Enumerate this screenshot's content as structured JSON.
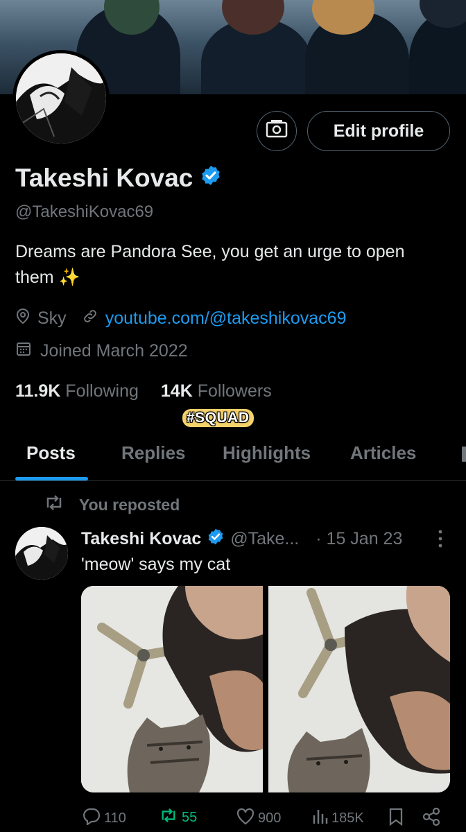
{
  "profile": {
    "name": "Takeshi Kovac",
    "handle": "@TakeshiKovac69",
    "bio": "Dreams are Pandora See, you get an urge to open them ✨",
    "location": "Sky",
    "website": "youtube.com/@takeshikovac69",
    "joined": "Joined March 2022",
    "following_count": "11.9K",
    "following_label": "Following",
    "followers_count": "14K",
    "followers_label": "Followers",
    "highlight_tag": "#SQUAD",
    "edit_button": "Edit profile"
  },
  "tabs": [
    {
      "label": "Posts",
      "active": true
    },
    {
      "label": "Replies",
      "active": false
    },
    {
      "label": "Highlights",
      "active": false
    },
    {
      "label": "Articles",
      "active": false
    }
  ],
  "post": {
    "repost_label": "You reposted",
    "author_name": "Takeshi Kovac",
    "author_handle": "@Take...",
    "date": "· 15 Jan 23",
    "text": "'meow' says my cat",
    "replies": "110",
    "reposts": "55",
    "likes": "900",
    "views": "185K"
  },
  "colors": {
    "accent": "#1d9bf0",
    "repost_active": "#00ba7c",
    "muted": "#71767b",
    "text": "#e7e9ea",
    "background": "#000000"
  },
  "icons": [
    "camera-money-icon",
    "verified-icon",
    "location-icon",
    "link-icon",
    "calendar-icon",
    "repost-icon",
    "more-icon",
    "reply-icon",
    "like-icon",
    "views-icon",
    "bookmark-icon",
    "share-icon"
  ]
}
